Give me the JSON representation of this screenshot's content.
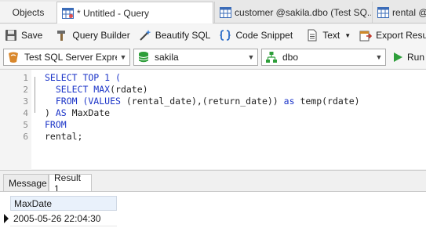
{
  "tabs": [
    {
      "label": "Objects"
    },
    {
      "label": "* Untitled - Query"
    },
    {
      "label": "customer @sakila.dbo (Test SQ..."
    },
    {
      "label": "rental @"
    }
  ],
  "toolbar": {
    "save": "Save",
    "query_builder": "Query Builder",
    "beautify": "Beautify SQL",
    "snippet": "Code Snippet",
    "text": "Text",
    "export": "Export Result"
  },
  "selectors": {
    "connection": "Test SQL Server Expres",
    "database": "sakila",
    "schema": "dbo",
    "run": "Run"
  },
  "editor": {
    "line_numbers": [
      "1",
      "2",
      "3",
      "4",
      "5",
      "6"
    ],
    "lines": [
      [
        {
          "t": "SELECT TOP 1 (",
          "k": true
        }
      ],
      [
        {
          "t": "  SELECT MAX",
          "k": true
        },
        {
          "t": "(rdate)",
          "k": false
        }
      ],
      [
        {
          "t": "  FROM (VALUES ",
          "k": true
        },
        {
          "t": "(rental_date),(return_date)) ",
          "k": false
        },
        {
          "t": "as ",
          "k": true
        },
        {
          "t": "temp(rdate)",
          "k": false
        }
      ],
      [
        {
          "t": ") ",
          "k": false
        },
        {
          "t": "AS ",
          "k": true
        },
        {
          "t": "MaxDate",
          "k": false
        }
      ],
      [
        {
          "t": "FROM",
          "k": true
        }
      ],
      [
        {
          "t": "rental;",
          "k": false
        }
      ]
    ]
  },
  "results": {
    "tabs": [
      "Message",
      "Result 1"
    ],
    "column": "MaxDate",
    "rows": [
      "2005-05-26 22:04:30"
    ]
  },
  "colors": {
    "keyword": "#1c35c8",
    "run_green": "#2e9e3a"
  }
}
